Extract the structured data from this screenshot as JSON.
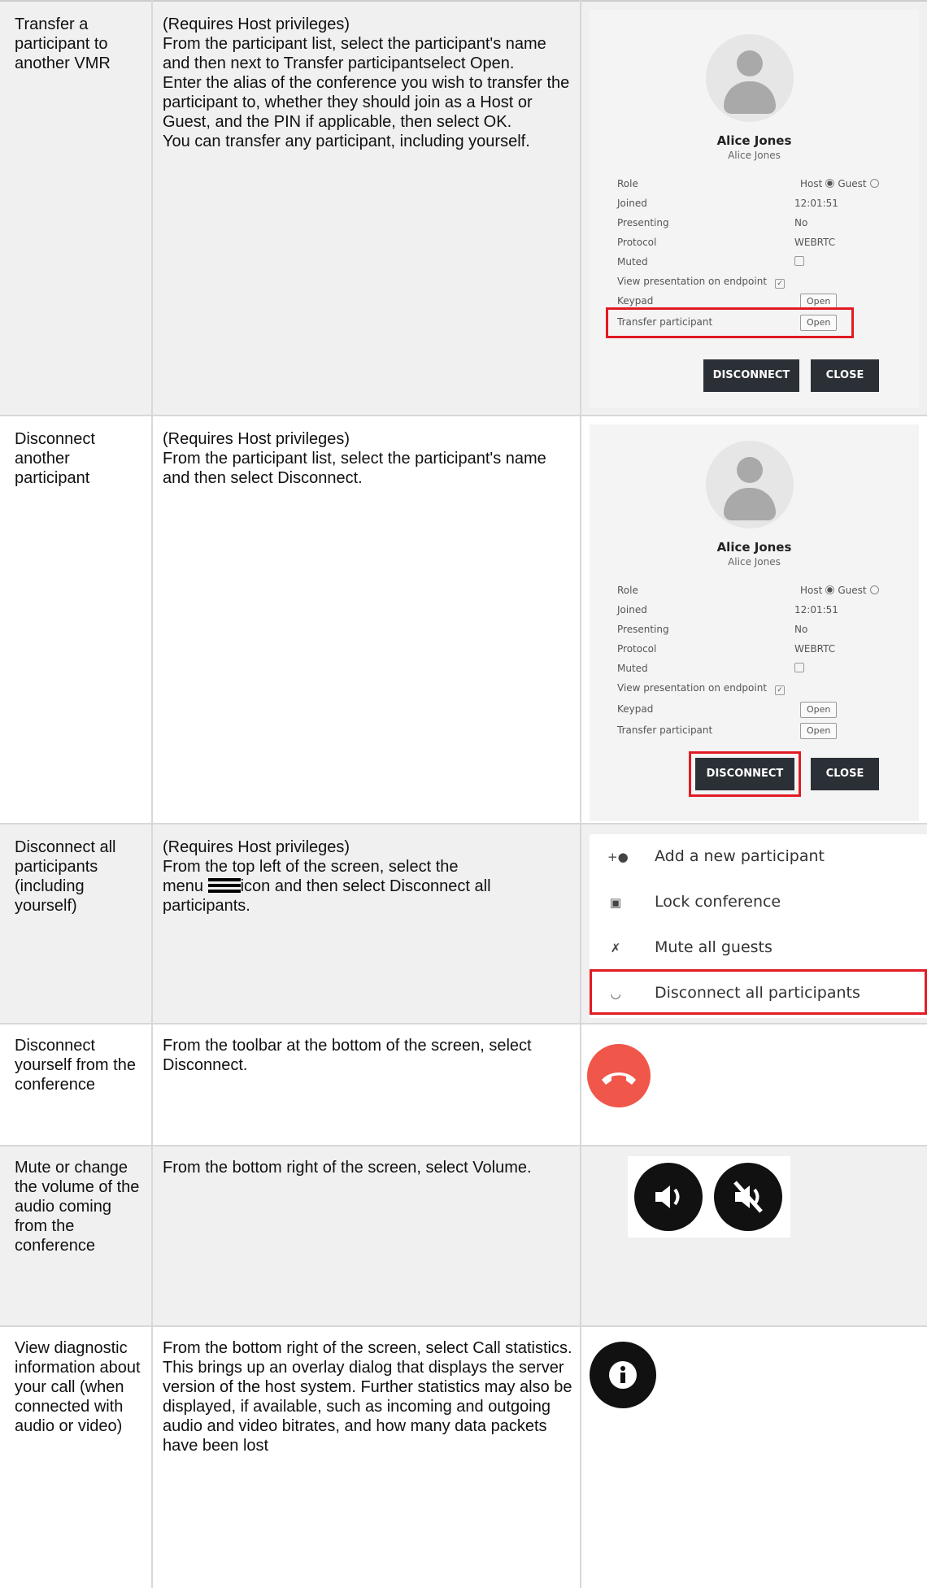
{
  "rows": [
    {
      "action": "Transfer a participant to another VMR",
      "lines": [
        "(Requires Host privileges)",
        "From the participant list, select the participant's name and then next to Transfer participantselect Open.",
        "Enter the alias of the conference you wish to transfer the participant to, whether they should join as a Host or Guest, and the PIN if applicable, then select OK.",
        "You can transfer any participant, including yourself."
      ]
    },
    {
      "action": "Disconnect another participant",
      "lines": [
        "(Requires Host privileges)",
        "From the participant list, select the participant's name and then select Disconnect."
      ]
    },
    {
      "action": "Disconnect all participants (including yourself)",
      "lines": [
        "(Requires Host privileges)",
        "From the top left of the screen, select the",
        "icon and then select Disconnect all participants."
      ],
      "menu_word": "menu"
    },
    {
      "action": "Disconnect yourself from the conference",
      "lines": [
        "From the toolbar at the bottom of the screen, select Disconnect."
      ]
    },
    {
      "action": "Mute or change the volume of the audio coming from the conference",
      "lines": [
        "From the bottom right of the screen, select Volume."
      ]
    },
    {
      "action": "View diagnostic information about your call (when connected with audio or video)",
      "lines": [
        "From the bottom right of the screen, select Call statistics.",
        "This brings up an overlay dialog that displays the server version of the host system. Further statistics may also be displayed, if available, such as incoming and outgoing audio and video bitrates, and how many data packets have been lost"
      ]
    }
  ],
  "dialog": {
    "name": "Alice Jones",
    "subname": "Alice Jones",
    "props": [
      {
        "label": "Role",
        "value": "",
        "host": "Host",
        "guest": "Guest"
      },
      {
        "label": "Joined",
        "value": "12:01:51"
      },
      {
        "label": "Presenting",
        "value": "No"
      },
      {
        "label": "Protocol",
        "value": "WEBRTC"
      },
      {
        "label": "Muted",
        "value": ""
      },
      {
        "label": "View presentation on endpoint",
        "value": ""
      },
      {
        "label": "Keypad",
        "button": "Open"
      },
      {
        "label": "Transfer participant",
        "button": "Open"
      }
    ],
    "disconnect_label": "DISCONNECT",
    "close_label": "CLOSE"
  },
  "menu": {
    "items": [
      {
        "label": "Add a new participant",
        "icon": "add-person-icon"
      },
      {
        "label": "Lock conference",
        "icon": "lock-icon"
      },
      {
        "label": "Mute all guests",
        "icon": "mic-off-icon"
      },
      {
        "label": "Disconnect all participants",
        "icon": "hang-up-icon"
      }
    ]
  },
  "colors": {
    "highlight": "#e11b22",
    "hangup": "#f0564a",
    "dark_button": "#2b3036"
  }
}
